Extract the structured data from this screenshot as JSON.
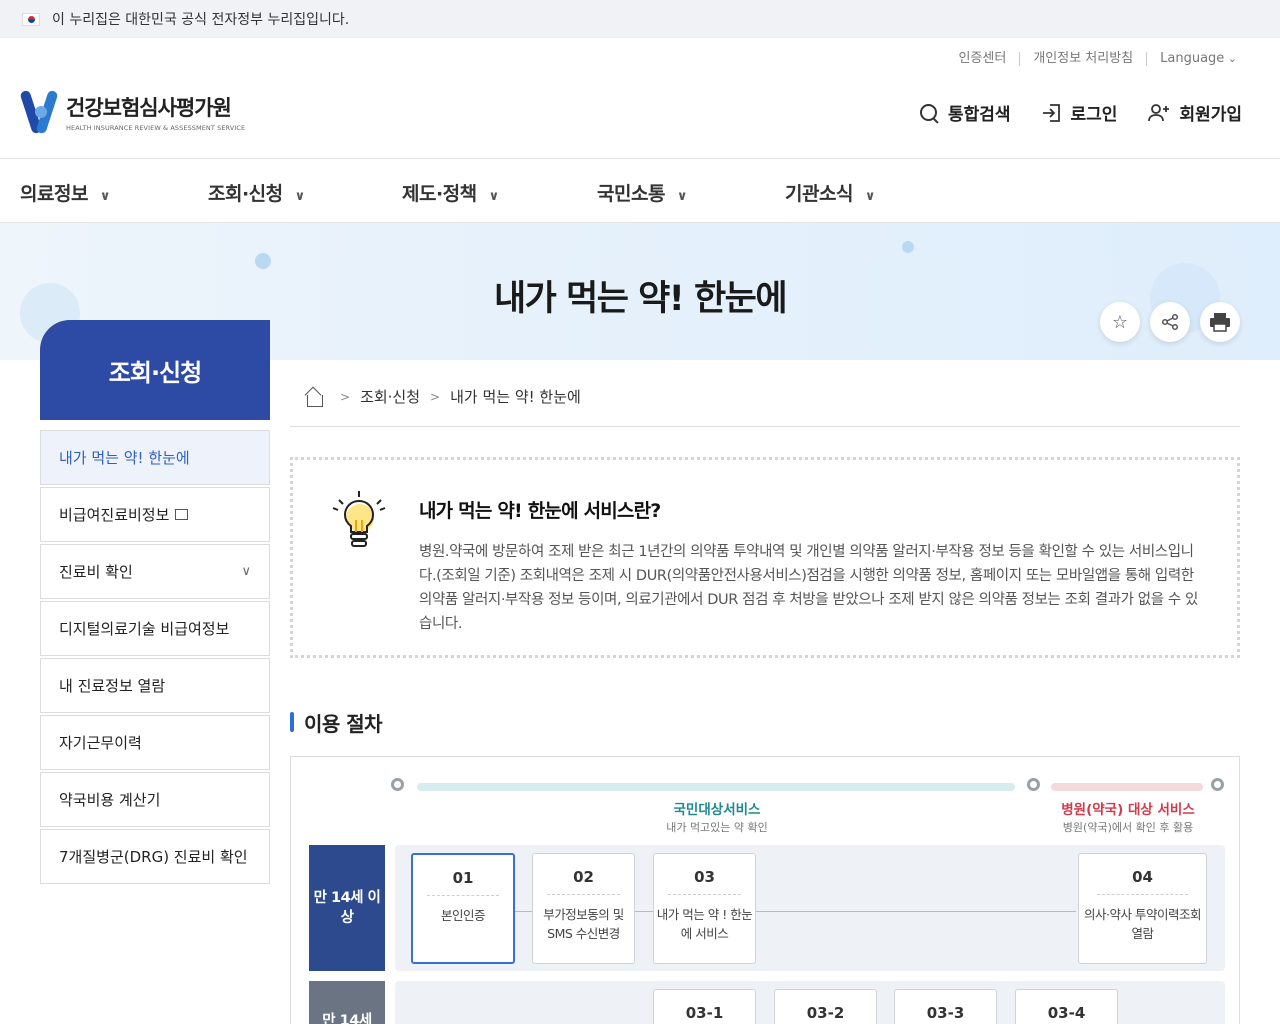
{
  "gov_bar": {
    "text": "이 누리집은 대한민국 공식 전자정부 누리집입니다."
  },
  "header": {
    "util": [
      "인증센터",
      "개인정보 처리방침",
      "Language"
    ],
    "logo_ko": "건강보험심사평가원",
    "logo_en": "HEALTH INSURANCE REVIEW & ASSESSMENT SERVICE",
    "actions": {
      "search": "통합검색",
      "login": "로그인",
      "join": "회원가입"
    }
  },
  "gnb": [
    "의료정보",
    "조회·신청",
    "제도·정책",
    "국민소통",
    "기관소식"
  ],
  "visual": {
    "title": "내가 먹는 약! 한눈에"
  },
  "lnb": {
    "title": "조회·신청",
    "items": [
      "내가 먹는 약! 한눈에",
      "비급여진료비정보",
      "진료비 확인",
      "디지털의료기술 비급여정보",
      "내 진료정보 열람",
      "자기근무이력",
      "약국비용 계산기",
      "7개질병군(DRG) 진료비 확인"
    ]
  },
  "breadcrumb": [
    "조회·신청",
    "내가 먹는 약! 한눈에"
  ],
  "intro": {
    "title": "내가 먹는 약! 한눈에 서비스란?",
    "desc": "병원.약국에 방문하여 조제 받은 최근 1년간의 의약품 투약내역 및 개인별 의약품 알러지·부작용 정보 등을 확인할 수 있는 서비스입니다.(조회일 기준) 조회내역은 조제 시 DUR(의약품안전사용서비스)점검을 시행한 의약품 정보, 홈페이지 또는 모바일앱을 통해 입력한 의약품 알러지·부작용 정보 등이며, 의료기관에서 DUR 점검 후 처방을 받았으나 조제 받지 않은 의약품 정보는 조회 결과가 없을 수 있습니다."
  },
  "process": {
    "section_title": "이용 절차",
    "svc1_title": "국민대상서비스",
    "svc1_sub": "내가 먹고있는 약 확인",
    "svc2_title": "병원(약국) 대상 서비스",
    "svc2_sub": "병원(약국)에서 확인 후 활용",
    "age1": "만 14세 이상",
    "age2": "만 14세",
    "steps_row1": [
      {
        "num": "01",
        "label": "본인인증"
      },
      {
        "num": "02",
        "label": "부가정보동의 및 SMS 수신변경"
      },
      {
        "num": "03",
        "label": "내가 먹는 약 ! 한눈에 서비스"
      },
      {
        "num": "04",
        "label": "의사·약사 투약이력조회 열람"
      }
    ],
    "steps_row2": [
      "03-1",
      "03-2",
      "03-3",
      "03-4"
    ]
  },
  "colors": {
    "primary": "#2d4aa5",
    "accent": "#2d6fd8",
    "svc1": "#1d8a8f",
    "svc2": "#d23a4a"
  }
}
